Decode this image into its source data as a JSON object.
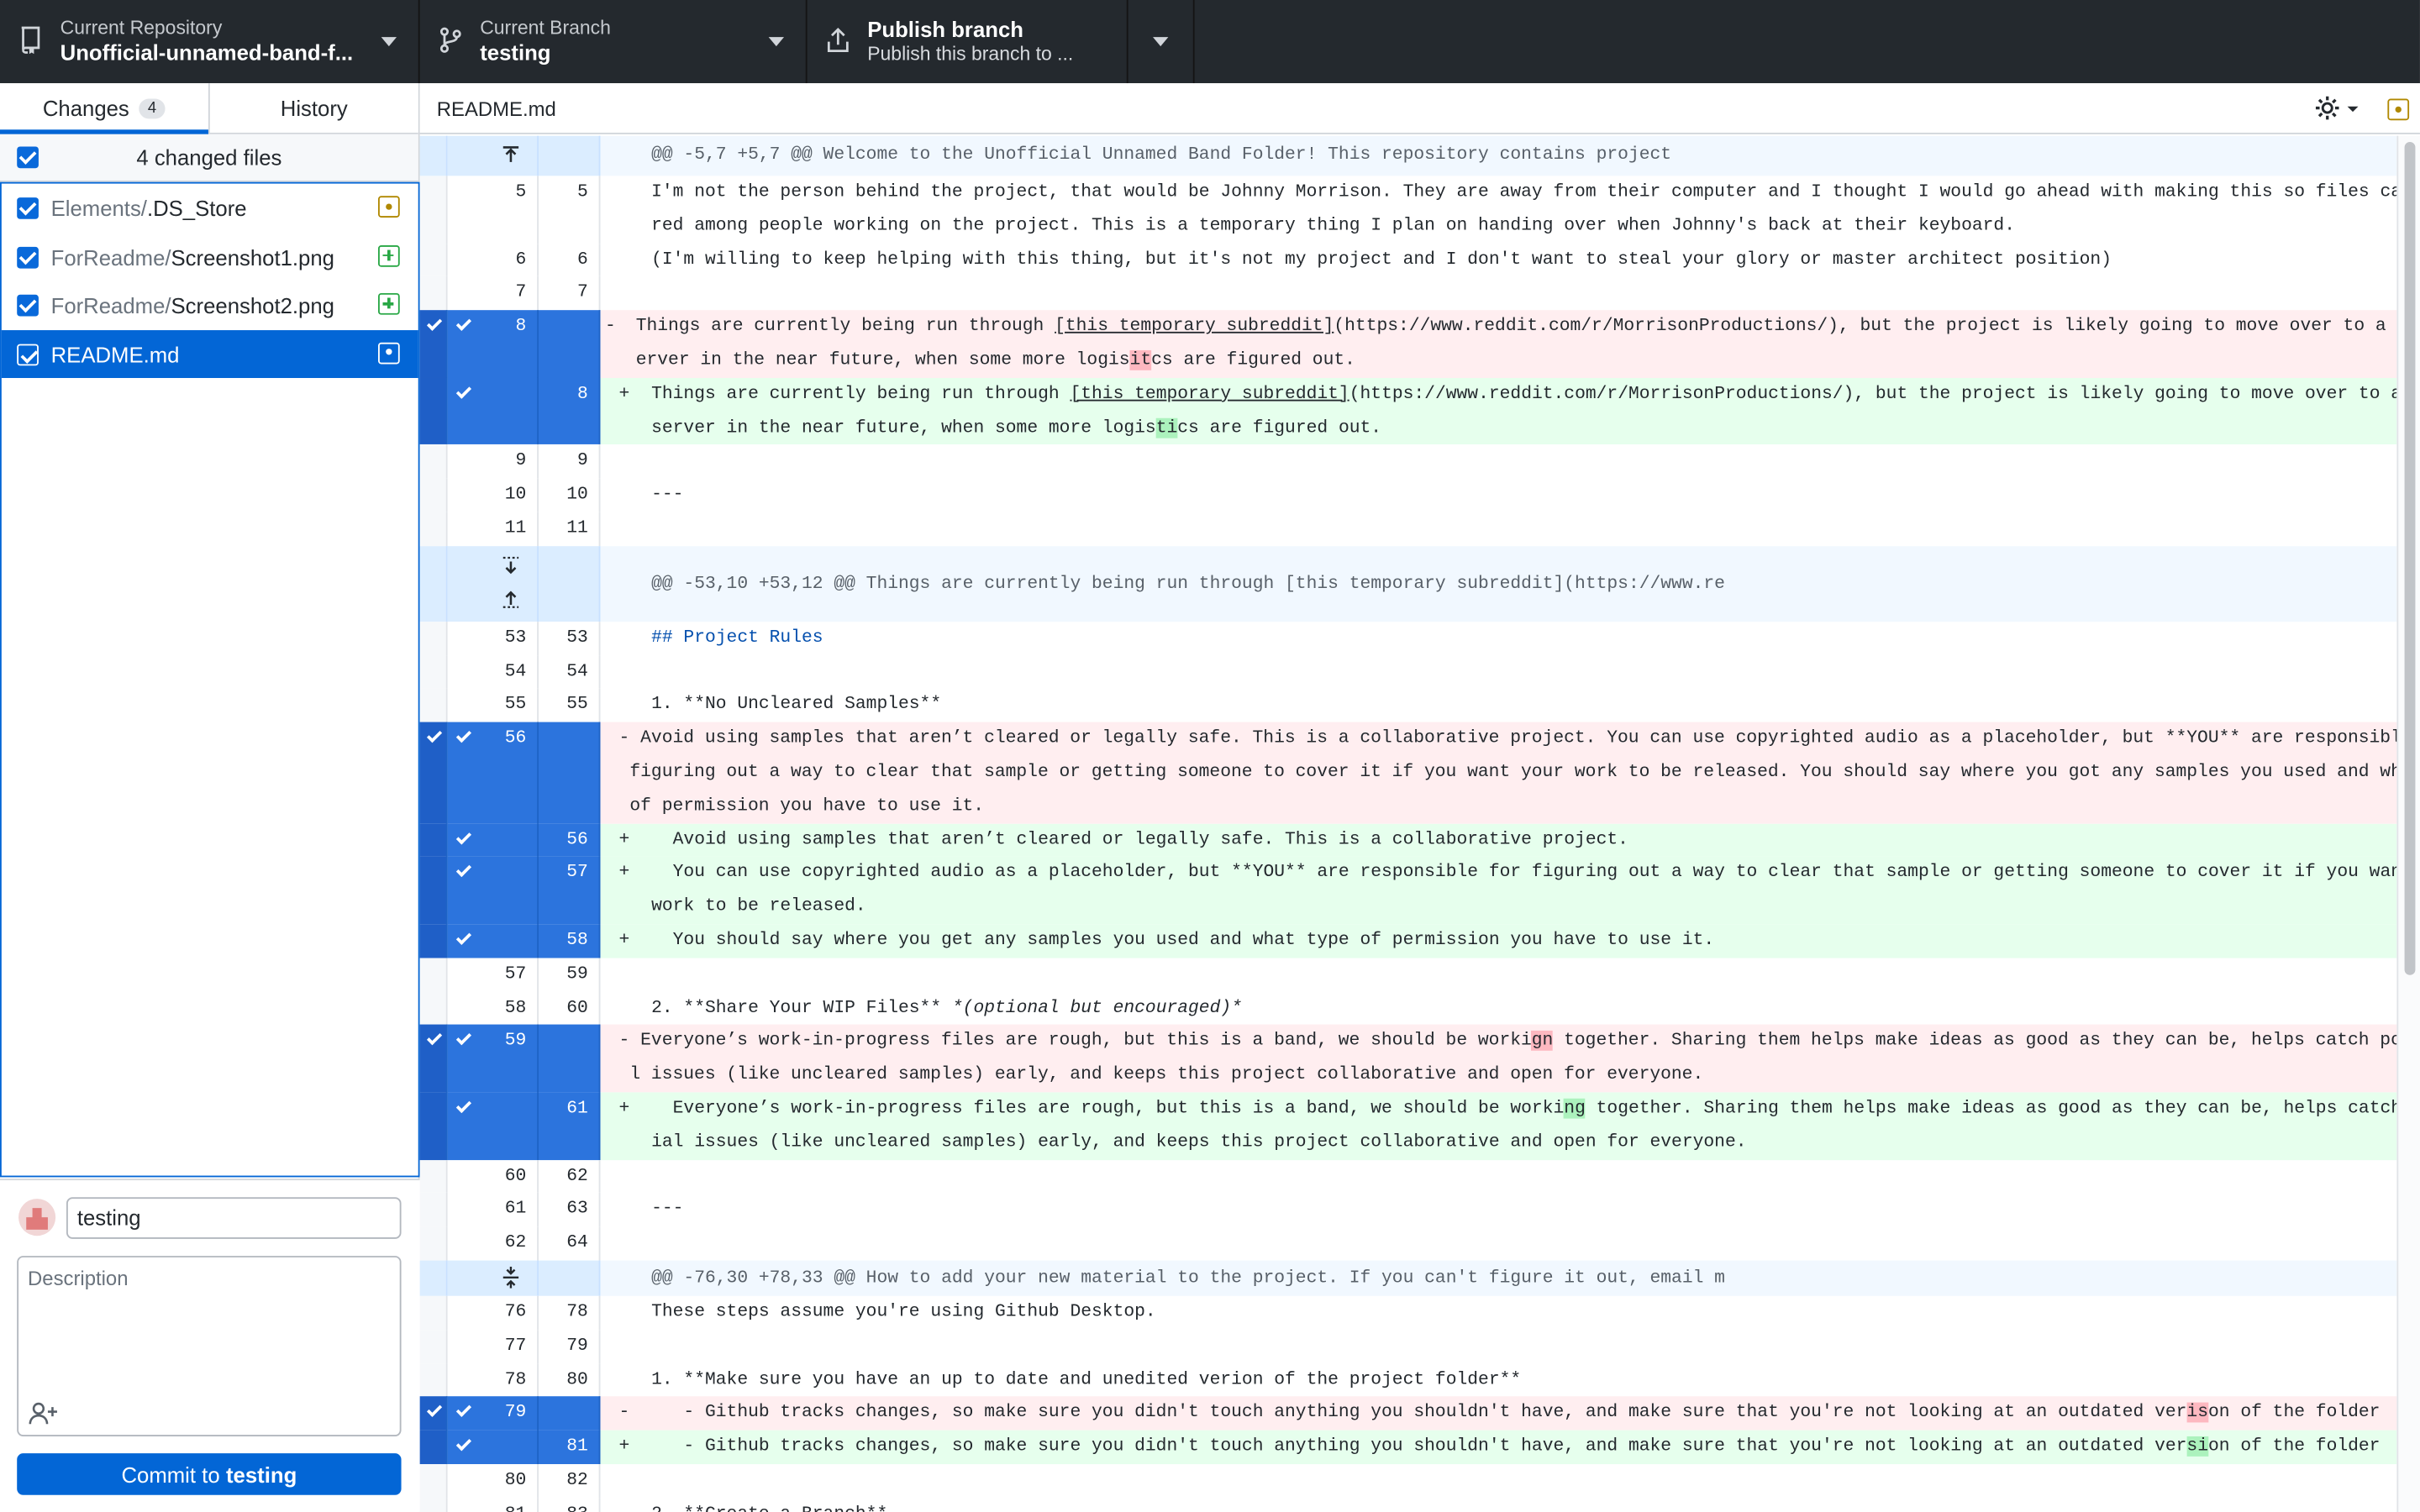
{
  "toolbar": {
    "repository": {
      "label": "Current Repository",
      "value": "Unofficial-unnamed-band-f..."
    },
    "branch": {
      "label": "Current Branch",
      "value": "testing"
    },
    "publish": {
      "title": "Publish branch",
      "subtitle": "Publish this branch to ..."
    }
  },
  "sidebar": {
    "tabs": [
      {
        "label": "Changes",
        "badge": "4"
      },
      {
        "label": "History"
      }
    ],
    "changed_files_header": "4 changed files",
    "files": [
      {
        "dir": "Elements/",
        "name": ".DS_Store",
        "status": "modified"
      },
      {
        "dir": "ForReadme/",
        "name": "Screenshot1.png",
        "status": "added"
      },
      {
        "dir": "ForReadme/",
        "name": "Screenshot2.png",
        "status": "added"
      },
      {
        "dir": "",
        "name": "README.md",
        "status": "modified"
      }
    ],
    "commit": {
      "summary_value": "testing",
      "description_placeholder": "Description",
      "button_prefix": "Commit to",
      "button_branch": "testing"
    }
  },
  "diff": {
    "filename": "README.md",
    "hunks": [
      "@@ -5,7 +5,7 @@ Welcome to the Unofficial Unnamed Band Folder! This repository contains project",
      "@@ -53,10 +53,12 @@ Things are currently being run through [this temporary subreddit](https://www.re",
      "@@ -76,30 +78,33 @@ How to add your new material to the project. If you can't figure it out, email m"
    ],
    "lines": {
      "l5a": "I'm not the person behind the project, that would be Johnny Morrison. They are away from their computer and I thought I would go ahead with making this so files can be sha",
      "l5b": "red among people working on the project. This is a temporary thing I plan on handing over when Johnny's back at their keyboard.",
      "l6": "(I'm willing to keep helping with this thing, but it's not my project and I don't want to steal your glory or master architect position)",
      "d8a_pre": "Things are currently being run through ",
      "d8a_link": "[this temporary subreddit]",
      "d8a_post": "(https://www.reddit.com/r/MorrisonProductions/), but the project is likely going to move over to a discord s",
      "d8b_pre": "erver in the near future, when some more logis",
      "d8b_hl": "it",
      "d8b_post": "cs are figured out.",
      "a8a_pre": "Things are currently being run through ",
      "a8a_link": "[this temporary subreddit]",
      "a8a_post": "(https://www.reddit.com/r/MorrisonProductions/), but the project is likely going to move over to a discord",
      "a8b_pre": "server in the near future, when some more logis",
      "a8b_hl": "ti",
      "a8b_post": "cs are figured out.",
      "l10": "---",
      "l53": "## Project Rules",
      "l55": "1. **No Uncleared Samples**",
      "d56a": " Avoid using samples that aren’t cleared or legally safe. This is a collaborative project. You can use copyrighted audio as a placeholder, but **YOU** are responsible for",
      "d56b": "figuring out a way to clear that sample or getting someone to cover it if you want your work to be released. You should say where you got any samples you used and what type",
      "d56c": "of permission you have to use it.",
      "a56": "  Avoid using samples that aren’t cleared or legally safe. This is a collaborative project.",
      "a57a": "  You can use copyrighted audio as a placeholder, but **YOU** are responsible for figuring out a way to clear that sample or getting someone to cover it if you want your",
      "a57b": "work to be released.",
      "a58": "  You should say where you get any samples you used and what type of permission you have to use it.",
      "l60_pre": "2. **Share Your WIP Files** ",
      "l60_em": "*(optional but encouraged)*",
      "d59a_pre": " Everyone’s work-in-progress files are rough, but this is a band, we should be worki",
      "d59a_hl": "gn",
      "d59a_post": " together. Sharing them helps make ideas as good as they can be, helps catch potentia",
      "d59b": "l issues (like uncleared samples) early, and keeps this project collaborative and open for everyone.",
      "a61a_pre": "  Everyone’s work-in-progress files are rough, but this is a band, we should be worki",
      "a61a_hl": "ng",
      "a61a_post": " together. Sharing them helps make ideas as good as they can be, helps catch potent",
      "a61b": "ial issues (like uncleared samples) early, and keeps this project collaborative and open for everyone.",
      "l63": "---",
      "l78": "These steps assume you're using Github Desktop.",
      "l80": "1. **Make sure you have an up to date and unedited verion of the project folder**",
      "d79_pre": "   - Github tracks changes, so make sure you didn't touch anything you shouldn't have, and make sure that you're not looking at an outdated ver",
      "d79_hl": "is",
      "d79_post": "on of the folder",
      "a81_pre": "   - Github tracks changes, so make sure you didn't touch anything you shouldn't have, and make sure that you're not looking at an outdated ver",
      "a81_hl": "si",
      "a81_post": "on of the folder",
      "l82": "2. **Create a Branch**"
    },
    "line_numbers": {
      "r1": [
        "5",
        "5"
      ],
      "r2": [
        "6",
        "6"
      ],
      "r3": [
        "7",
        "7"
      ],
      "r4": [
        "8",
        ""
      ],
      "r5": [
        "",
        "8"
      ],
      "r6": [
        "9",
        "9"
      ],
      "r7": [
        "10",
        "10"
      ],
      "r8": [
        "11",
        "11"
      ],
      "r9": [
        "53",
        "53"
      ],
      "r10": [
        "54",
        "54"
      ],
      "r11": [
        "55",
        "55"
      ],
      "r12": [
        "56",
        ""
      ],
      "r13": [
        "",
        "56"
      ],
      "r14": [
        "",
        "57"
      ],
      "r15": [
        "",
        "58"
      ],
      "r16": [
        "57",
        "59"
      ],
      "r17": [
        "58",
        "60"
      ],
      "r18": [
        "59",
        ""
      ],
      "r19": [
        "",
        "61"
      ],
      "r20": [
        "60",
        "62"
      ],
      "r21": [
        "61",
        "63"
      ],
      "r22": [
        "62",
        "64"
      ],
      "r23": [
        "76",
        "78"
      ],
      "r24": [
        "77",
        "79"
      ],
      "r25": [
        "78",
        "80"
      ],
      "r26": [
        "79",
        ""
      ],
      "r27": [
        "",
        "81"
      ],
      "r28": [
        "80",
        "82"
      ],
      "r29": [
        "81",
        "83"
      ]
    }
  }
}
